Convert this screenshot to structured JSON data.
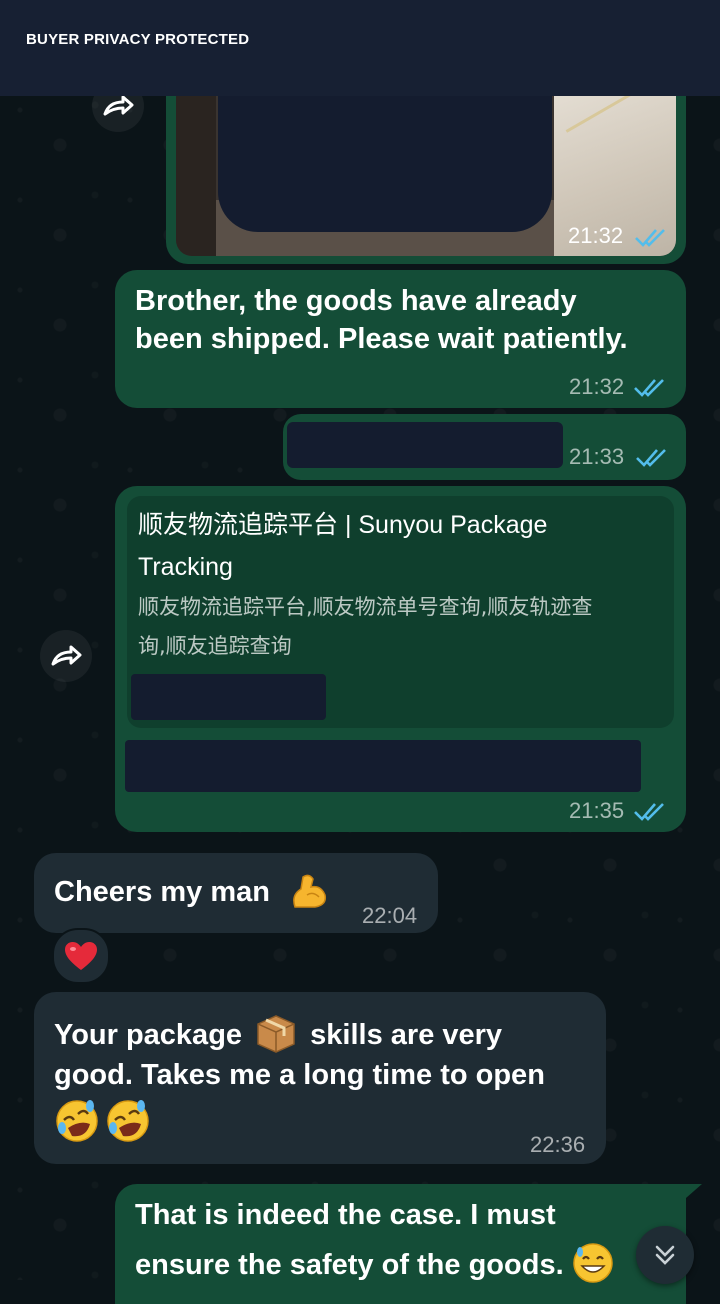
{
  "header": {
    "privacy_label": "BUYER PRIVACY PROTECTED"
  },
  "messages": {
    "image_msg": {
      "time": "21:32",
      "status": "read"
    },
    "shipped_msg": {
      "line1": "Brother, the goods have already",
      "line2": "been shipped. Please wait patiently.",
      "time": "21:32",
      "status": "read"
    },
    "redacted_msg": {
      "time": "21:33",
      "status": "read"
    },
    "link_msg": {
      "preview_title_line1": "顺友物流追踪平台 | Sunyou Package",
      "preview_title_line2": "Tracking",
      "preview_desc_line1": "顺友物流追踪平台,顺友物流单号查询,顺友轨迹查",
      "preview_desc_line2": "询,顺友追踪查询",
      "time": "21:35",
      "status": "read"
    },
    "cheers_msg": {
      "text": "Cheers my man",
      "emoji": "flexed-biceps",
      "time": "22:04",
      "reaction": "red-heart"
    },
    "package_msg": {
      "line1_a": "Your package",
      "line1_b": "skills are very",
      "line2": "good. Takes me a long time to open",
      "emoji_box": "package",
      "emoji_laugh": "rolling-on-floor-laughing",
      "time": "22:36"
    },
    "safety_msg": {
      "line1": "That is indeed the case. I must",
      "line2": "ensure the safety of the goods.",
      "emoji": "grinning-sweat"
    }
  },
  "colors": {
    "outgoing": "#144d37",
    "incoming": "#1f2c34",
    "read_tick": "#53bdeb",
    "redaction": "#141c2f"
  }
}
